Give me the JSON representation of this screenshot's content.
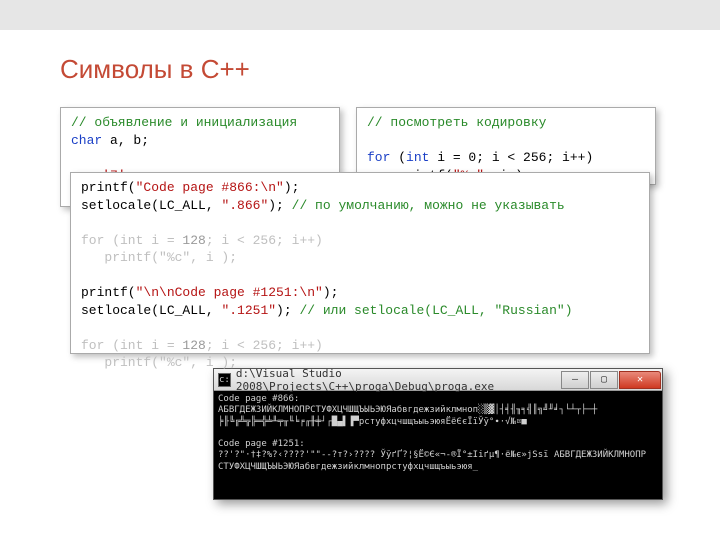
{
  "title": "Символы в C++",
  "box_left": {
    "comment": "// объявление и инициализация",
    "kw_char": "char",
    "decl": " a, b;",
    "assign": "a = ",
    "char_lit": "'7'",
    "semi": ";"
  },
  "box_right": {
    "comment": "// посмотреть кодировку",
    "kw_for": "for",
    "for_open": " (",
    "kw_int": "int",
    "for_rest": " i = 0; i < 256; i++)",
    "printf": "    printf(",
    "fmt": "\"%c\"",
    "printf_end": ", i );"
  },
  "box_wide": {
    "l1a": "printf(",
    "l1s": "\"Code page #866:\\n\"",
    "l1b": ");",
    "l2a": "setlocale(LC_ALL, ",
    "l2s": "\".866\"",
    "l2b": "); ",
    "l2c": "// по умолчанию, можно не указывать",
    "faded_for1a": "for (int i = ",
    "faded_for1_num": "128",
    "faded_for1b": "; i < 256; i++)",
    "faded_printf1": "   printf(\"%c\", i );",
    "l5a": "printf(",
    "l5s": "\"\\n\\nCode page #1251:\\n\"",
    "l5b": ");",
    "l6a": "setlocale(LC_ALL, ",
    "l6s": "\".1251\"",
    "l6b": "); ",
    "l6c": "// или setlocale(LC_ALL, \"Russian\")",
    "faded_for2a": "for (int i = ",
    "faded_for2_num": "128",
    "faded_for2b": "; i < 256; i++)",
    "faded_printf2": "   printf(\"%c\", i );"
  },
  "console": {
    "title": "d:\\Visual Studio 2008\\Projects\\C++\\proga\\Debug\\proga.exe",
    "line1": "Code page #866:",
    "line2": "АБВГДЕЖЗИЙКЛМНОПРСТУФХЦЧШЩЪЫЬЭЮЯабвгдежзийклмноп░▒▓│┤╡╢╖╕╣║╗╝╜╛┐└┴┬├─┼",
    "line3": "╞╟╚╔╩╦╠═╬╧╨╤╥╙╘╒╓╫╪┘┌█▄▌▐▀рстуфхцчшщъыьэюяЁёЄєЇїЎў°∙·√№¤■",
    "line4": "Code page #1251:",
    "line5": "??'?\"·†‡?%?‹????'\"\"--?т?›???? ЎўґҐ?¦§Ё©Є«¬-®Ї°±Ііґµ¶·ё№є»јЅѕї АБВГДЕЖЗИЙКЛМНОПР",
    "line6": "СТУФХЦЧШЩЪЫЬЭЮЯабвгдежзийклмнопрстуфхцчшщъыьэюя_"
  }
}
